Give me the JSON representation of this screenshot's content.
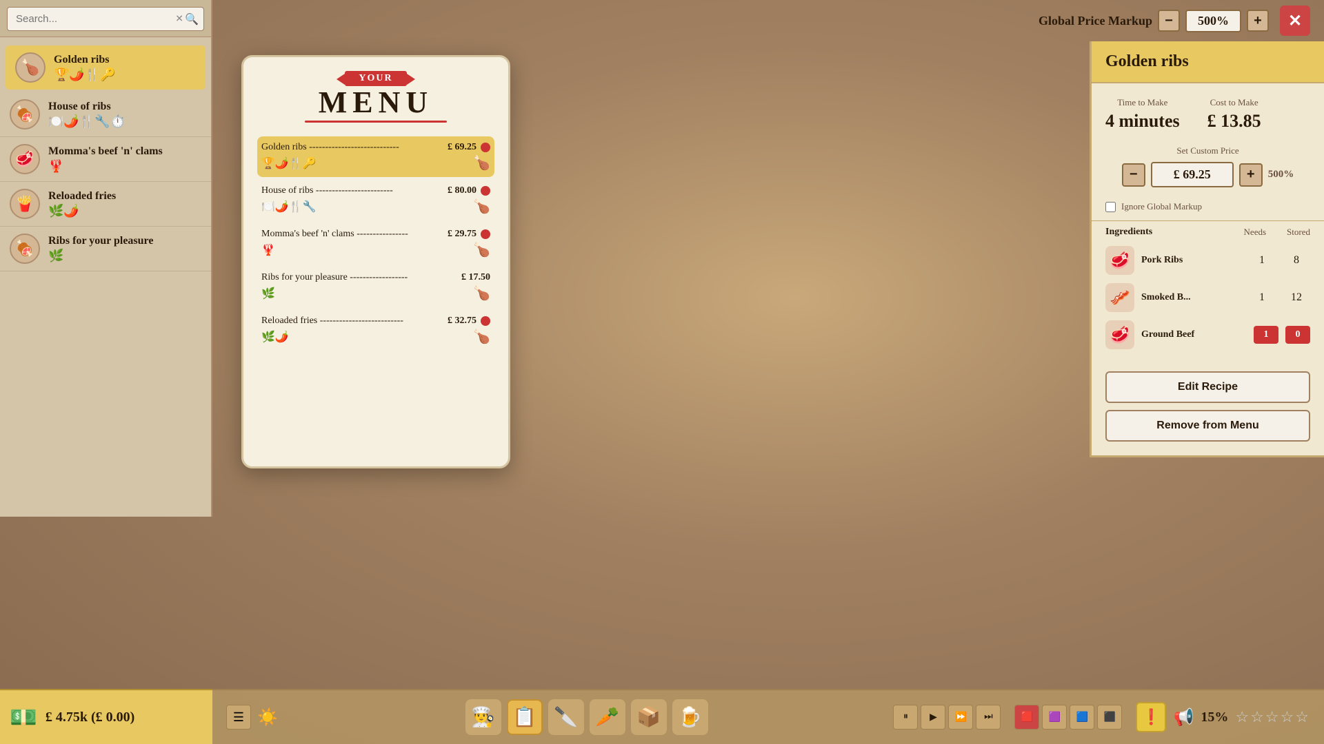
{
  "topbar": {
    "global_markup_label": "Global Price Markup",
    "markup_minus": "−",
    "markup_value": "500%",
    "markup_plus": "+",
    "close_label": "✕"
  },
  "sidebar": {
    "search_placeholder": "Search...",
    "items": [
      {
        "name": "Golden ribs",
        "icon": "🍗",
        "tags": "🏆🌶️🍴🔑",
        "active": true
      },
      {
        "name": "House of ribs",
        "icon": "🍖",
        "tags": "🍽️🌶️🍴🔧⏱️",
        "active": false
      },
      {
        "name": "Momma's beef 'n' clams",
        "icon": "🥩",
        "tags": "🦞",
        "active": false
      },
      {
        "name": "Reloaded fries",
        "icon": "🍟",
        "tags": "🌿🌶️",
        "active": false
      },
      {
        "name": "Ribs for your pleasure",
        "icon": "🍖",
        "tags": "🌿",
        "active": false
      }
    ]
  },
  "money": {
    "amount": "£ 4.75k (£ 0.00)"
  },
  "menu_board": {
    "your_label": "YOUR",
    "title": "MENU",
    "entries": [
      {
        "name": "Golden ribs",
        "dashes": "----------------------------",
        "price": "£ 69.25",
        "has_dot": true,
        "highlighted": true,
        "tags": "🏆🌶️🍴🔑",
        "dish_icon": "🍗"
      },
      {
        "name": "House of ribs",
        "dashes": "------------------------",
        "price": "£ 80.00",
        "has_dot": true,
        "highlighted": false,
        "tags": "🍽️🌶️🍴🔧",
        "dish_icon": "🍗"
      },
      {
        "name": "Momma's beef 'n' clams",
        "dashes": "----------------",
        "price": "£ 29.75",
        "has_dot": true,
        "highlighted": false,
        "tags": "🦞",
        "dish_icon": "🍗"
      },
      {
        "name": "Ribs for your pleasure",
        "dashes": "------------------",
        "price": "£ 17.50",
        "has_dot": false,
        "highlighted": false,
        "tags": "🌿",
        "dish_icon": "🍗"
      },
      {
        "name": "Reloaded fries",
        "dashes": "--------------------------",
        "price": "£ 32.75",
        "has_dot": true,
        "highlighted": false,
        "tags": "🌿🌶️",
        "dish_icon": "🍗"
      }
    ]
  },
  "detail": {
    "title": "Golden ribs",
    "time_label": "Time to Make",
    "time_value": "4 minutes",
    "cost_label": "Cost to Make",
    "cost_value": "£ 13.85",
    "set_price_label": "Set Custom Price",
    "price_minus": "−",
    "price_value": "£ 69.25",
    "price_plus": "+",
    "price_percent": "500%",
    "ignore_markup_label": "Ignore Global Markup",
    "ingredients_label": "Ingredients",
    "needs_label": "Needs",
    "stored_label": "Stored",
    "ingredients": [
      {
        "name": "Pork Ribs",
        "icon": "🥩",
        "needs": "1",
        "stored": "8",
        "needs_ok": true,
        "stored_ok": true
      },
      {
        "name": "Smoked B...",
        "icon": "🥓",
        "needs": "1",
        "stored": "12",
        "needs_ok": true,
        "stored_ok": true
      },
      {
        "name": "Ground Beef",
        "icon": "🥩",
        "needs": "1",
        "stored": "0",
        "needs_ok": false,
        "stored_ok": false
      }
    ],
    "edit_recipe_label": "Edit Recipe",
    "remove_label": "Remove from Menu"
  },
  "taskbar": {
    "icons": [
      "👨‍🍳",
      "📋",
      "🔪",
      "🥕",
      "📦",
      "🍺"
    ],
    "rating_percent": "15%",
    "stars": "☆☆☆☆☆",
    "controls": {
      "pause": "⏸",
      "play": "▶",
      "fast": "⏩",
      "faster": "⏭"
    }
  }
}
